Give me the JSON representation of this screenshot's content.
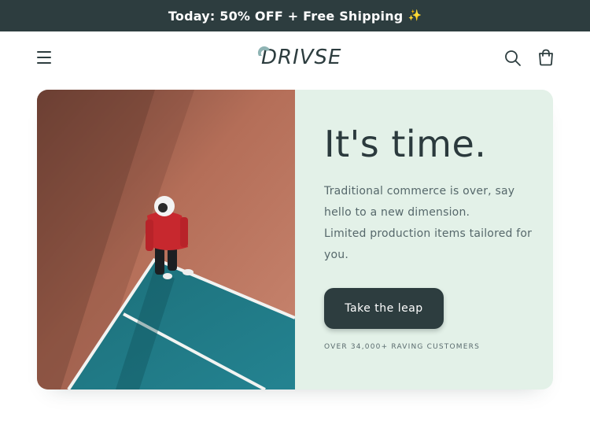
{
  "announcement": {
    "text": "Today: 50% OFF + Free Shipping",
    "emoji": "✨"
  },
  "header": {
    "logo_text": "DRIVSE",
    "icons": [
      "menu-icon",
      "search-icon",
      "cart-icon"
    ]
  },
  "hero": {
    "title": "It's time.",
    "description_line1": "Traditional commerce is over, say hello to a new dimension.",
    "description_line2": "Limited production items tailored for you.",
    "cta_label": "Take the leap",
    "social_proof": "OVER 34,000+ RAVING CUSTOMERS"
  },
  "colors": {
    "announcement_bg": "#2d3d3f",
    "hero_panel_bg": "#e3f1e8",
    "button_bg": "#2d3d3f",
    "court_clay": "#c27a63",
    "court_teal": "#1e7b86",
    "logo_accent": "#8fb4b4"
  }
}
